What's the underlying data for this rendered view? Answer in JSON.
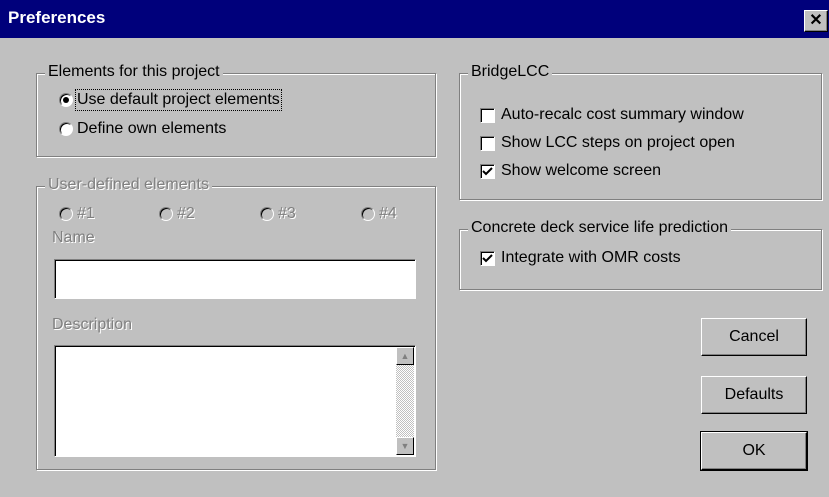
{
  "window": {
    "title": "Preferences",
    "close_glyph": "✕"
  },
  "elements_group": {
    "legend": "Elements for this project",
    "options": [
      {
        "label": "Use default project elements",
        "selected": true
      },
      {
        "label": "Define own elements",
        "selected": false
      }
    ]
  },
  "user_defined": {
    "legend": "User-defined elements",
    "radios": [
      "#1",
      "#2",
      "#3",
      "#4"
    ],
    "name_label": "Name",
    "name_value": "",
    "description_label": "Description",
    "description_value": ""
  },
  "bridgelcc": {
    "legend": "BridgeLCC",
    "options": [
      {
        "label": "Auto-recalc cost summary window",
        "checked": false
      },
      {
        "label": "Show LCC steps on project open",
        "checked": false
      },
      {
        "label": "Show welcome screen",
        "checked": true
      }
    ]
  },
  "concrete": {
    "legend": "Concrete deck service life prediction",
    "options": [
      {
        "label": "Integrate with OMR costs",
        "checked": true
      }
    ]
  },
  "buttons": {
    "cancel": "Cancel",
    "defaults": "Defaults",
    "ok": "OK"
  }
}
